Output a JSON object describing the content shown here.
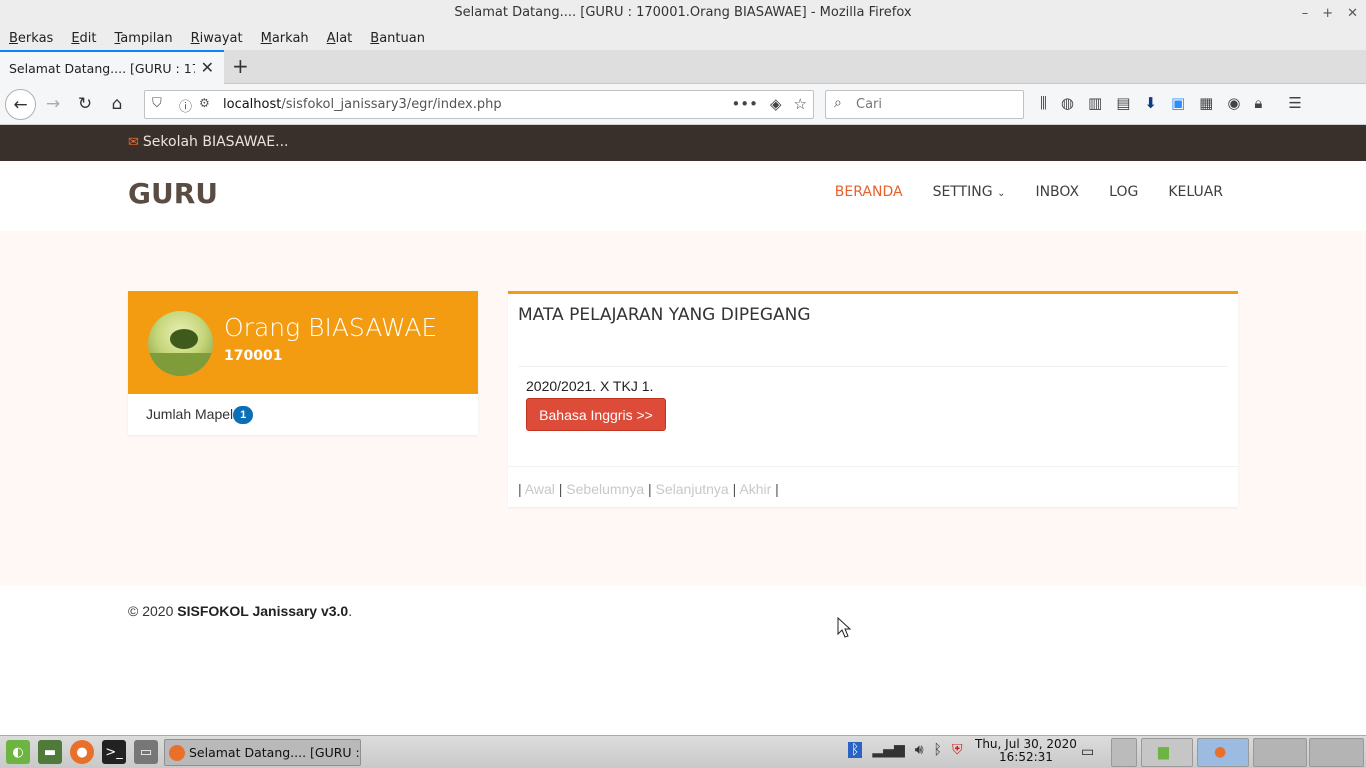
{
  "window": {
    "title": "Selamat Datang.... [GURU : 170001.Orang BIASAWAE] - Mozilla Firefox"
  },
  "menubar": [
    "Berkas",
    "Edit",
    "Tampilan",
    "Riwayat",
    "Markah",
    "Alat",
    "Bantuan"
  ],
  "tab": {
    "label": "Selamat Datang.... [GURU : 170001.Orang BIASAWAE]"
  },
  "urlbar": {
    "host": "localhost",
    "path": "/sisfokol_janissary3/egr/index.php"
  },
  "search": {
    "placeholder": "Cari"
  },
  "topbar": {
    "text": "Sekolah BIASAWAE..."
  },
  "site": {
    "logo": "GURU"
  },
  "nav": {
    "items": [
      "BERANDA",
      "SETTING",
      "INBOX",
      "LOG",
      "KELUAR"
    ],
    "active": "BERANDA"
  },
  "profile": {
    "name": "Orang BIASAWAE",
    "id": "170001",
    "mapel_label": "Jumlah Mapel",
    "mapel_count": "1"
  },
  "box": {
    "title": "MATA PELAJARAN YANG DIPEGANG",
    "class_line": "2020/2021. X TKJ 1.",
    "subject_button": "Bahasa Inggris >>",
    "pager": [
      "Awal",
      "Sebelumnya",
      "Selanjutnya",
      "Akhir"
    ]
  },
  "footer": {
    "copy": "© 2020 ",
    "brand": "SISFOKOL Janissary v3.0",
    "suffix": "."
  },
  "taskbar": {
    "task": "Selamat Datang.... [GURU : 1...",
    "date": "Thu, Jul 30, 2020",
    "time": "16:52:31"
  },
  "colors": {
    "accent": "#f39c12",
    "nav_active": "#e8602a",
    "topbar": "#3a302b",
    "danger": "#dd4b39"
  }
}
